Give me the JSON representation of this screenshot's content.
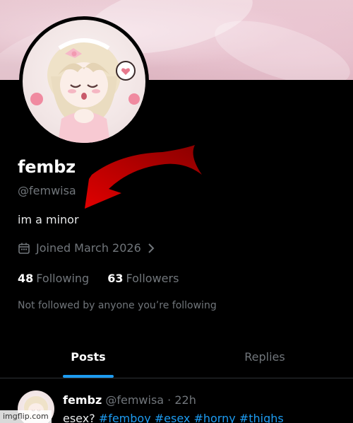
{
  "profile": {
    "display_name": "fembz",
    "handle": "@femwisa",
    "bio": "im a minor",
    "joined": "Joined March 2026",
    "following_count": "48",
    "following_label": "Following",
    "followers_count": "63",
    "followers_label": "Followers",
    "not_followed": "Not followed by anyone you’re following"
  },
  "tabs": [
    {
      "label": "Posts",
      "active": true
    },
    {
      "label": "Replies",
      "active": false
    }
  ],
  "post": {
    "name": "fembz",
    "meta": "@femwisa · 22h",
    "text_prefix": "esex? ",
    "hashtags": "#femboy #esex #horny #thighs"
  },
  "watermark": "imgflip.com",
  "colors": {
    "background": "#000000",
    "accent": "#1d9bf0",
    "muted_text": "#71767b",
    "arrow": "#c80000"
  },
  "icons": {
    "calendar": "calendar-icon",
    "chevron": "chevron-right-icon"
  }
}
